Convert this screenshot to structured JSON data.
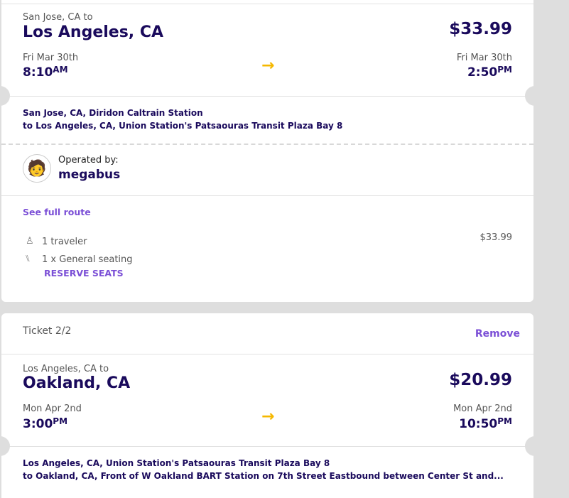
{
  "tickets": [
    {
      "from_label": "San Jose, CA to",
      "to_city": "Los Angeles, CA",
      "price": "$33.99",
      "dep_date": "Fri Mar 30th",
      "dep_time": "8:10",
      "dep_ampm": "AM",
      "arr_date": "Fri Mar 30th",
      "arr_time": "2:50",
      "arr_ampm": "PM",
      "origin_stop": "San Jose, CA, Diridon Caltrain Station",
      "dest_stop": "to  Los Angeles, CA, Union Station's Patsaouras Transit Plaza Bay 8",
      "operated_by": "Operated by:",
      "operator": "megabus",
      "see_route": "See full route",
      "travelers": "1 traveler",
      "seating": "1 x General seating",
      "reserve": "RESERVE SEATS",
      "line_price": "$33.99"
    },
    {
      "header": "Ticket 2/2",
      "remove": "Remove",
      "from_label": "Los Angeles, CA to",
      "to_city": "Oakland, CA",
      "price": "$20.99",
      "dep_date": "Mon Apr 2nd",
      "dep_time": "3:00",
      "dep_ampm": "PM",
      "arr_date": "Mon Apr 2nd",
      "arr_time": "10:50",
      "arr_ampm": "PM",
      "origin_stop": "Los Angeles, CA, Union Station's Patsaouras Transit Plaza Bay 8",
      "dest_stop": "to  Oakland, CA, Front of W Oakland BART Station on 7th Street Eastbound between Center St and..."
    }
  ],
  "colors": {
    "primary": "#1a0a5c",
    "link": "#7b4fd6",
    "arrow": "#f5b800",
    "background": "#dedede"
  }
}
